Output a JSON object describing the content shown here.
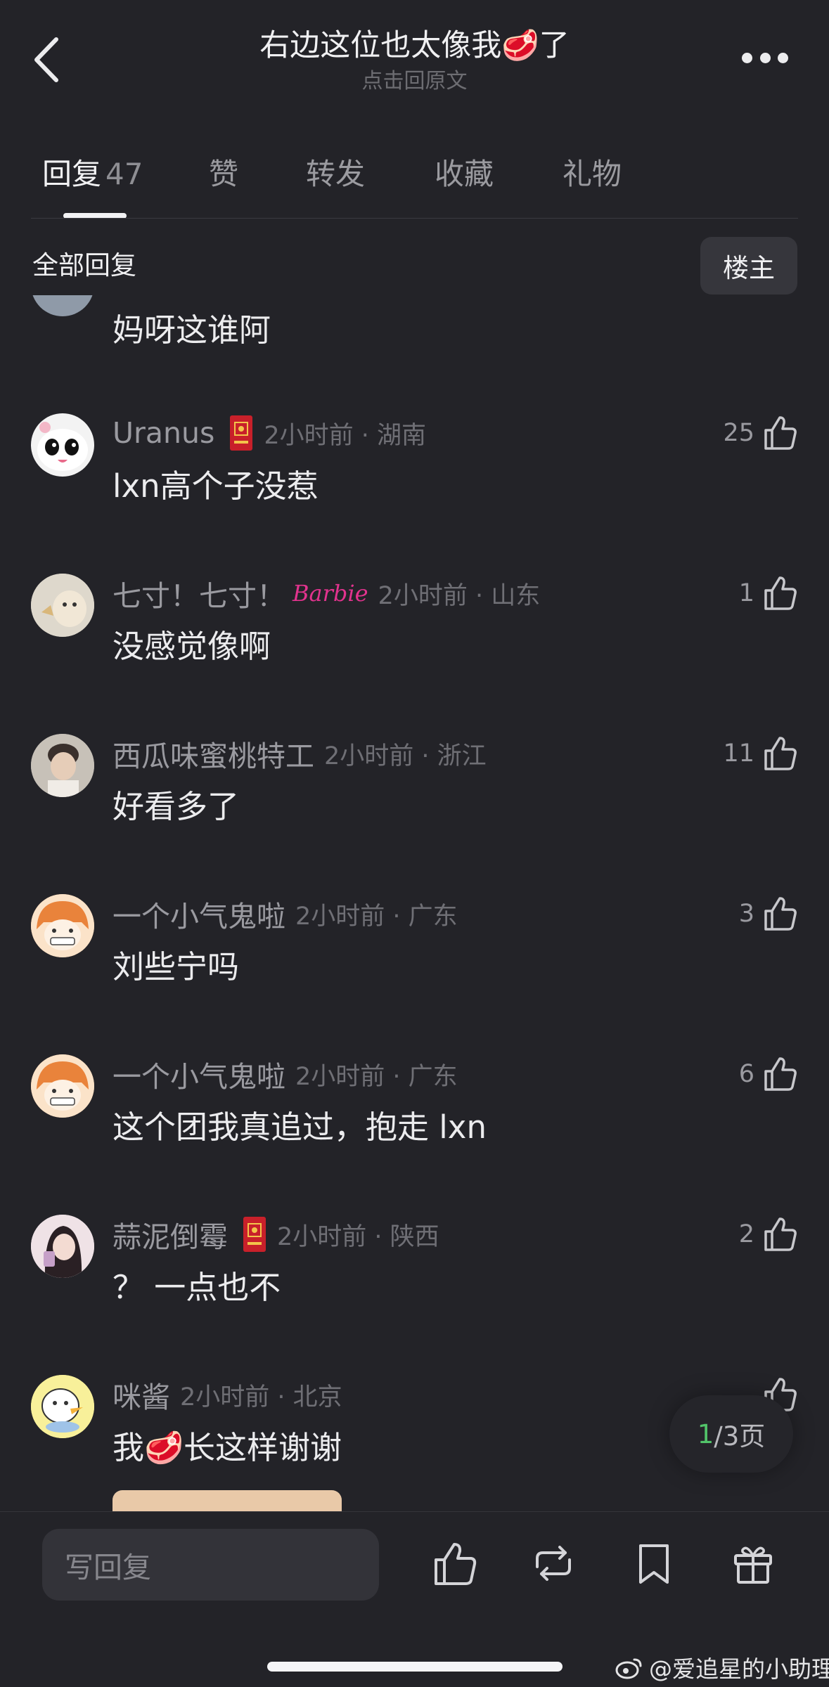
{
  "header": {
    "title": "右边这位也太像我🥩了",
    "subtitle": "点击回原文"
  },
  "tabs": [
    {
      "label": "回复",
      "count": "47",
      "active": true
    },
    {
      "label": "赞"
    },
    {
      "label": "转发"
    },
    {
      "label": "收藏"
    },
    {
      "label": "礼物"
    }
  ],
  "section": {
    "title": "全部回复",
    "op_button": "楼主"
  },
  "comments": [
    {
      "username": "",
      "time": "",
      "text": "妈呀这谁阿",
      "likes": ""
    },
    {
      "username": "Uranus",
      "time": "2小时前 · 湖南",
      "text": "lxn高个子没惹",
      "likes": "25",
      "badge": "red-envelope-icon"
    },
    {
      "username": "七寸！七寸！",
      "badge_text": "Barbie",
      "time": "2小时前 · 山东",
      "text": "没感觉像啊",
      "likes": "1"
    },
    {
      "username": "西瓜味蜜桃特工",
      "time": "2小时前 · 浙江",
      "text": "好看多了",
      "likes": "11"
    },
    {
      "username": "一个小气鬼啦",
      "time": "2小时前 · 广东",
      "text": "刘些宁吗",
      "likes": "3"
    },
    {
      "username": "一个小气鬼啦",
      "time": "2小时前 · 广东",
      "text": "这个团我真追过，抱走 lxn",
      "likes": "6"
    },
    {
      "username": "蒜泥倒霉",
      "time": "2小时前 · 陕西",
      "text": "？ 一点也不",
      "likes": "2",
      "badge": "red-envelope-icon"
    },
    {
      "username": "咪酱",
      "time": "2小时前 · 北京",
      "text": "我🥩长这样谢谢",
      "likes": ""
    }
  ],
  "pager": {
    "current": "1",
    "total": "/3页"
  },
  "bottom": {
    "reply_placeholder": "写回复",
    "icons": [
      "thumb-up-icon",
      "repost-icon",
      "bookmark-icon",
      "gift-icon"
    ]
  },
  "watermark": "@爱追星的小助理",
  "colors": {
    "background": "#232328",
    "accent_green": "#52c46a",
    "barbie_pink": "#e2338e"
  }
}
